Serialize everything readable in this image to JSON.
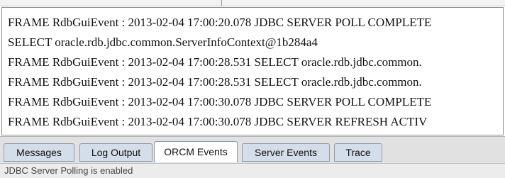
{
  "log": {
    "lines": [
      "FRAME RdbGuiEvent : 2013-02-04 17:00:20.078 JDBC SERVER POLL COMPLETE",
      "SELECT oracle.rdb.jdbc.common.ServerInfoContext@1b284a4",
      "FRAME RdbGuiEvent : 2013-02-04 17:00:28.531 SELECT oracle.rdb.jdbc.common.",
      "FRAME RdbGuiEvent : 2013-02-04 17:00:28.531 SELECT oracle.rdb.jdbc.common.",
      "FRAME RdbGuiEvent : 2013-02-04 17:00:30.078 JDBC SERVER POLL COMPLETE",
      "FRAME RdbGuiEvent : 2013-02-04 17:00:30.078 JDBC SERVER REFRESH ACTIV"
    ]
  },
  "tabs": [
    {
      "label": "Messages"
    },
    {
      "label": "Log Output"
    },
    {
      "label": "ORCM Events"
    },
    {
      "label": "Server Events"
    },
    {
      "label": "Trace"
    }
  ],
  "active_tab": "ORCM Events",
  "status": {
    "text": "JDBC Server Polling is enabled"
  }
}
